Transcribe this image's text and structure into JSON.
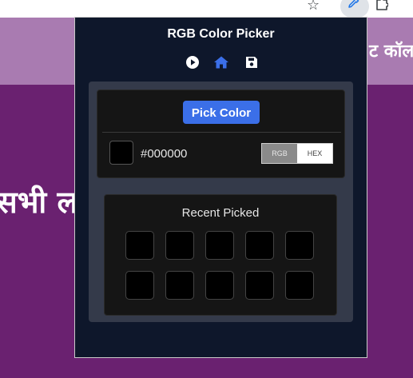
{
  "browser": {
    "star_icon": "star-icon",
    "extension_icon": "eyedropper-icon",
    "puzzle_icon": "puzzle-icon"
  },
  "background_page": {
    "header_text": "ट कॉल",
    "heading_text": "सभी ल"
  },
  "popup": {
    "title": "RGB Color Picker",
    "nav": [
      {
        "name": "play",
        "icon": "play-icon"
      },
      {
        "name": "home",
        "icon": "home-icon"
      },
      {
        "name": "save",
        "icon": "floppy-disk-icon"
      }
    ],
    "pick_button_label": "Pick Color",
    "current_color": {
      "value": "#000000",
      "swatch_color": "#000000"
    },
    "format_toggle": {
      "options": [
        "RGB",
        "HEX"
      ],
      "selected": "RGB"
    },
    "recent": {
      "title": "Recent Picked",
      "colors": [
        "#000000",
        "#000000",
        "#000000",
        "#000000",
        "#000000",
        "#000000",
        "#000000",
        "#000000",
        "#000000",
        "#000000"
      ]
    }
  },
  "colors": {
    "page_background": "#6a2170",
    "page_band": "#a97bb1",
    "popup_background": "#0e172b",
    "panel_background": "#343a4a",
    "card_background": "#151515",
    "accent_blue": "#3b6fe8",
    "icon_white": "#ffffff"
  }
}
